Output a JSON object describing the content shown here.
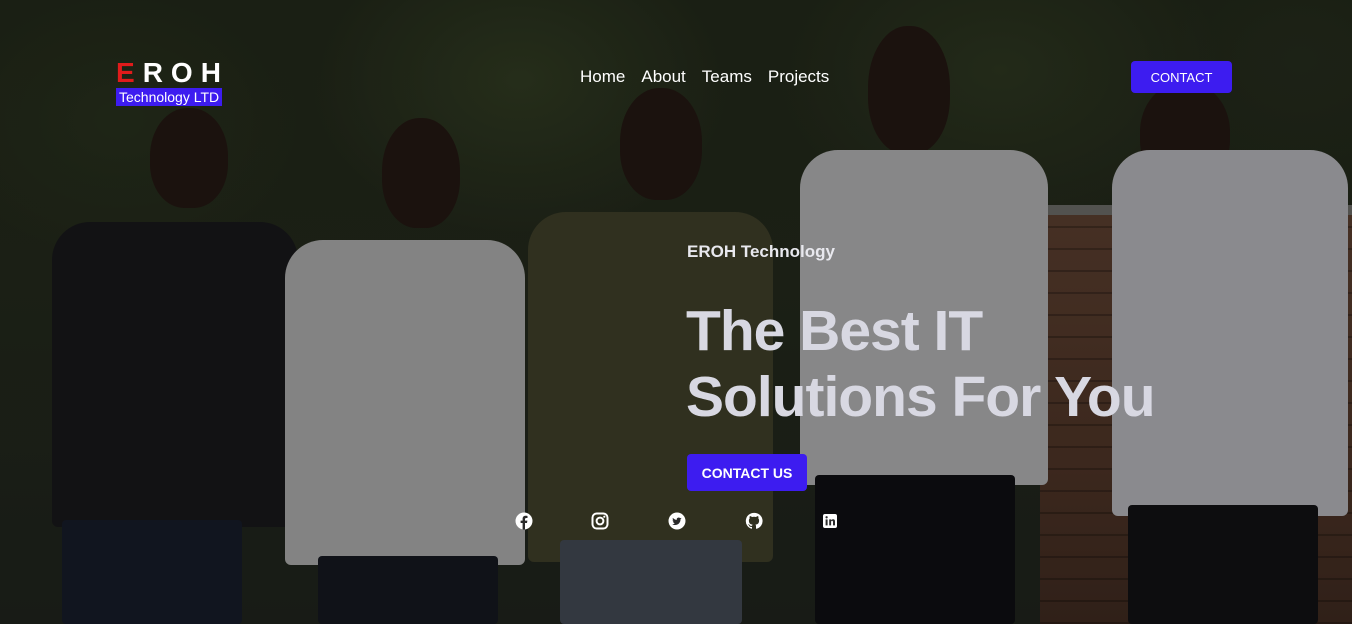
{
  "brand": {
    "first_letter": "E",
    "rest_letters": "ROH",
    "subtitle": "Technology LTD"
  },
  "nav": {
    "items": [
      {
        "label": "Home"
      },
      {
        "label": "About"
      },
      {
        "label": "Teams"
      },
      {
        "label": "Projects"
      }
    ],
    "contact_label": "CONTACT"
  },
  "hero": {
    "eyebrow": "EROH Technology",
    "headline_line1": "The Best IT",
    "headline_line2": "Solutions For You",
    "cta_label": "CONTACT US"
  },
  "socials": [
    "facebook-icon",
    "instagram-icon",
    "twitter-icon",
    "github-icon",
    "linkedin-icon"
  ],
  "colors": {
    "accent": "#3d1cf0",
    "logo_highlight": "#e01b1b",
    "headline": "#d8d8e2"
  }
}
